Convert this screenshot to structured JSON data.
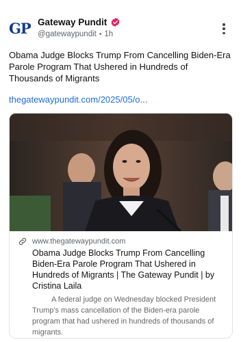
{
  "account": {
    "avatar_text": "GP",
    "display_name": "Gateway Pundit",
    "handle": "@gatewaypundit",
    "separator": "•",
    "time": "1h",
    "verified_color": "#e0245e"
  },
  "post": {
    "text": "Obama Judge Blocks Trump From Cancelling Biden-Era Parole Program That Ushered in Hundreds of Thousands of Migrants",
    "link": "thegatewaypundit.com/2025/05/o..."
  },
  "card": {
    "image_icon": "photo-of-woman-speaking-at-hearing",
    "domain": "www.thegatewaypundit.com",
    "title": "Obama Judge Blocks Trump From Cancelling Biden-Era Parole Program That Ushered in Hundreds of Migrants | The Gateway Pundit | by Cristina Laila",
    "description": "A federal judge on Wednesday blocked President Trump's mass cancellation of the Biden-era parole program that had ushered in hundreds of thousands of migrants."
  },
  "icons": {
    "more": "more-vertical-icon",
    "link": "link-icon",
    "verified": "verified-badge-icon"
  },
  "colors": {
    "link_blue": "#1d6cdb",
    "brand_navy": "#123c8c"
  }
}
